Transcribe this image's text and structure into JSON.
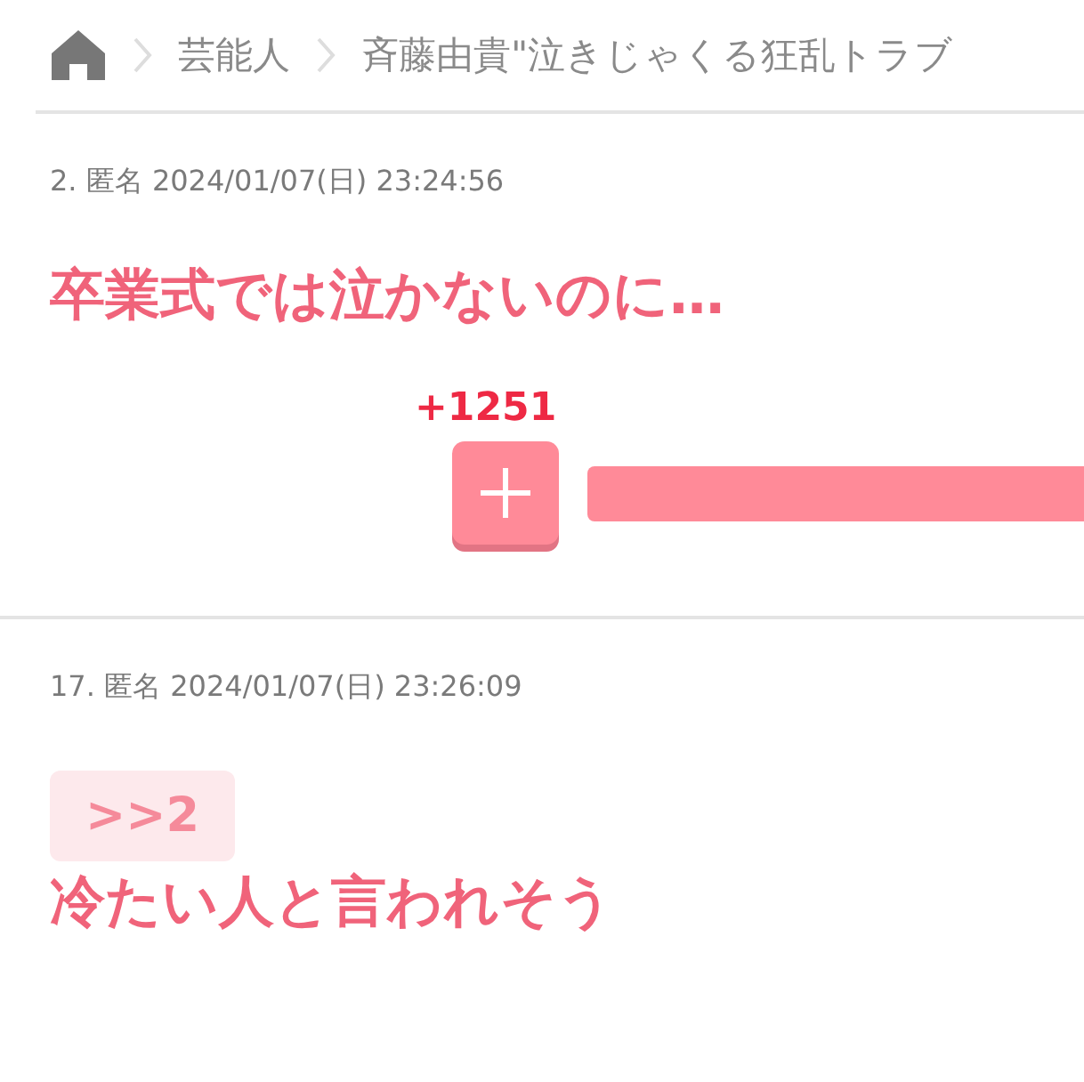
{
  "breadcrumb": [
    "芸能人",
    "斉藤由貴\"泣きじゃくる狂乱トラブ"
  ],
  "comments": [
    {
      "header": "2. 匿名 2024/01/07(日) 23:24:56",
      "body": "卒業式では泣かないのに…",
      "votes": "+1251"
    },
    {
      "header": "17. 匿名 2024/01/07(日) 23:26:09",
      "quote": ">>2",
      "body": "冷たい人と言われそう"
    }
  ]
}
